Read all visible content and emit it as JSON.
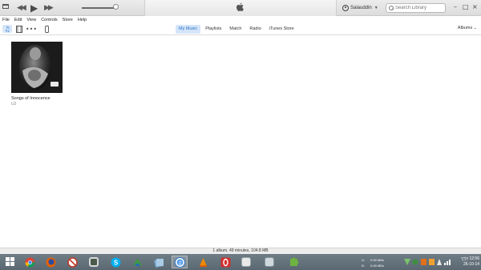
{
  "window": {
    "account_name": "Salauddin",
    "search": {
      "placeholder": "Search Library"
    },
    "controls": {
      "minimize": "–",
      "maximize": "□",
      "close": "×"
    }
  },
  "menu": [
    "File",
    "Edit",
    "View",
    "Controls",
    "Store",
    "Help"
  ],
  "nav": {
    "tabs": [
      "My Music",
      "Playlists",
      "Match",
      "Radio",
      "iTunes Store"
    ],
    "active_tab": "My Music",
    "view_label": "Albums"
  },
  "album": {
    "title": "Songs of Innocence",
    "artist": "U2"
  },
  "status": "1 album, 49 minutes, 104.8 MB",
  "taskbar": {
    "apps": [
      "file-explorer",
      "chrome",
      "firefox",
      "blocked-app",
      "library-app",
      "skype",
      "network-app",
      "files-app",
      "itunes",
      "vlc",
      "opera",
      "generic-window",
      "puzzle-app"
    ],
    "active_app": "itunes",
    "upload_label": "U:",
    "upload_speed": "0.00 kB/s",
    "download_label": "D:",
    "download_speed": "0.00 kB/s",
    "time": "দুপুর 12:56",
    "date": "26-10-14"
  },
  "colors": {
    "accent": "#2b74c9",
    "active_tab_bg": "#d4e5f8",
    "taskbar": "#65727c"
  }
}
